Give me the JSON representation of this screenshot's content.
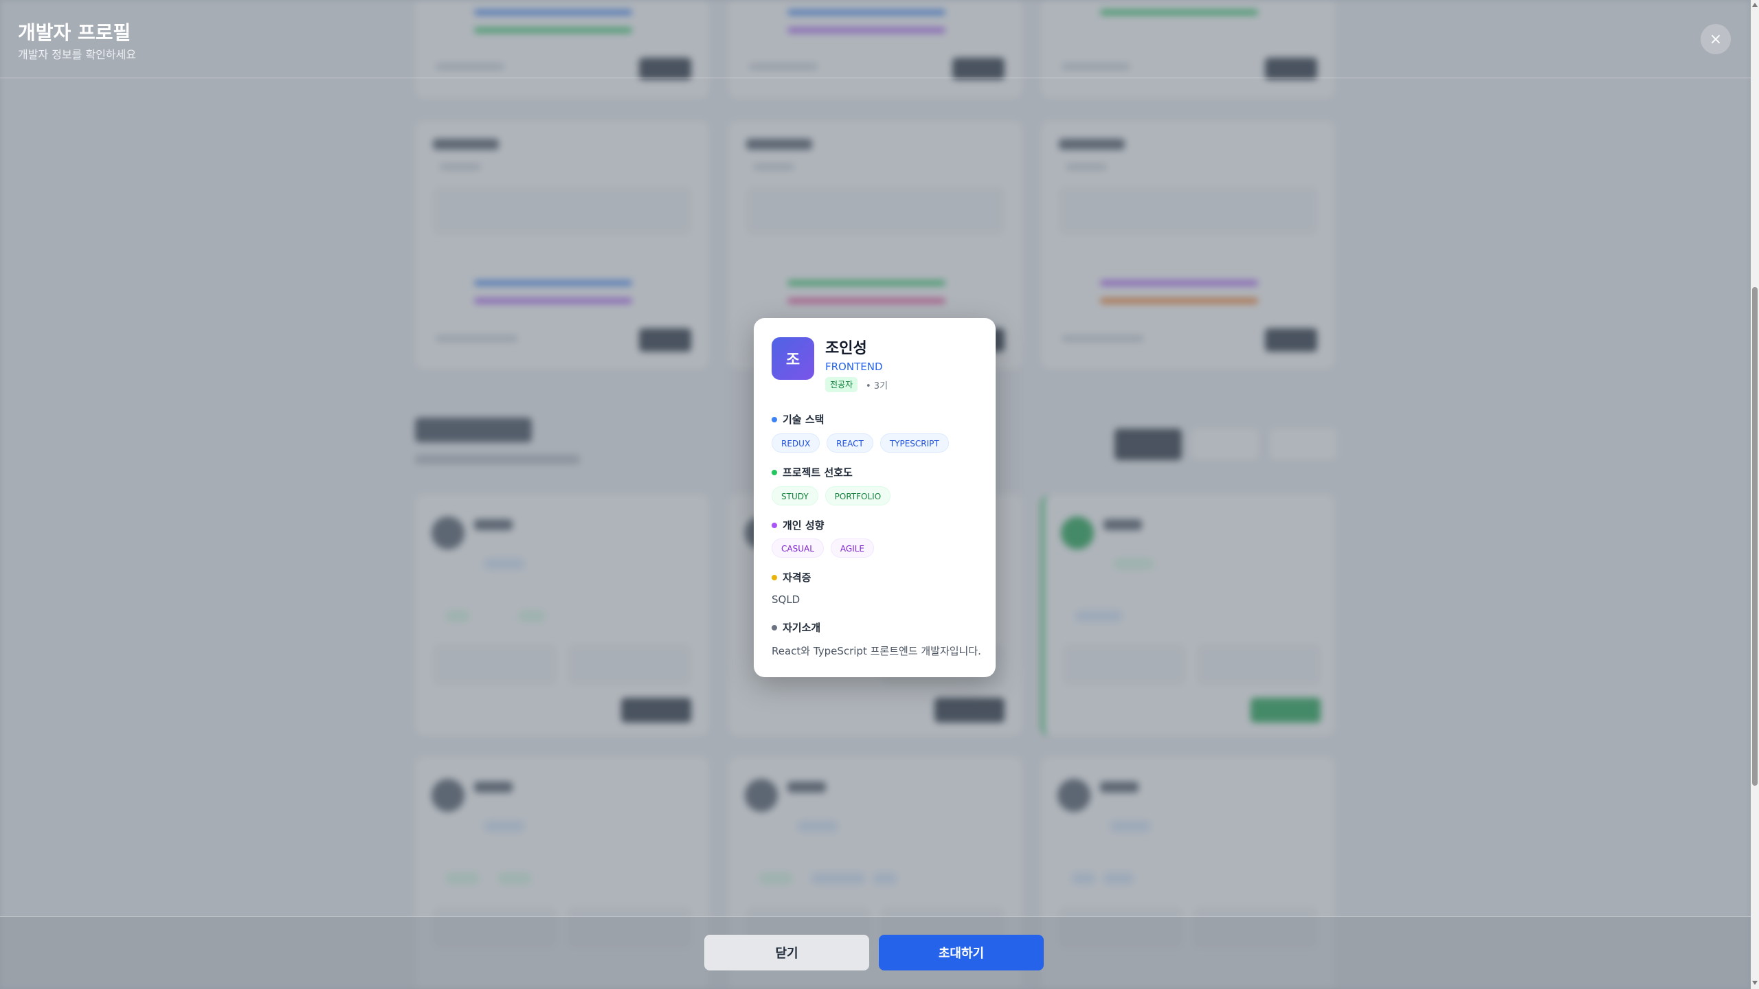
{
  "header": {
    "title": "개발자 프로필",
    "subtitle": "개발자 정보를 확인하세요",
    "close_icon": "×"
  },
  "profile": {
    "avatar_initial": "조",
    "name": "조인성",
    "role": "FRONTEND",
    "major_badge": "전공자",
    "cohort": "• 3기",
    "sections": {
      "tech_stack": {
        "title": "기술 스택",
        "dot_color": "#3b82f6",
        "tags": [
          "REDUX",
          "REACT",
          "TYPESCRIPT"
        ]
      },
      "project_pref": {
        "title": "프로젝트 선호도",
        "dot_color": "#22c55e",
        "tags": [
          "STUDY",
          "PORTFOLIO"
        ]
      },
      "personality": {
        "title": "개인 성향",
        "dot_color": "#a855f7",
        "tags": [
          "CASUAL",
          "AGILE"
        ]
      },
      "certificates": {
        "title": "자격증",
        "dot_color": "#eab308",
        "text": "SQLD"
      },
      "intro": {
        "title": "자기소개",
        "dot_color": "#6b7280",
        "text": "React와 TypeScript 프론트엔드 개발자입니다."
      }
    }
  },
  "footer": {
    "close_label": "닫기",
    "invite_label": "초대하기"
  },
  "colors": {
    "accent": "#2563eb",
    "avatar_gradient_start": "#4f63e6",
    "avatar_gradient_end": "#7a55e8"
  }
}
